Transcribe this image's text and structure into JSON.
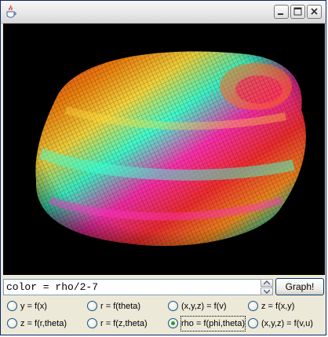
{
  "window": {
    "icon": "java-cup-icon",
    "controls": [
      "minimize-icon",
      "maximize-icon",
      "close-icon"
    ]
  },
  "graph": {
    "description_colors": [
      "#ff3030",
      "#ff8800",
      "#ffe020",
      "#30ffc0",
      "#ff40c0"
    ]
  },
  "input": {
    "value": "color = rho/2-7"
  },
  "graph_button": {
    "label": "Graph!"
  },
  "modes": [
    {
      "label": "y = f(x)",
      "checked": false
    },
    {
      "label": "r = f(theta)",
      "checked": false
    },
    {
      "label": "(x,y,z) = f(v)",
      "checked": false
    },
    {
      "label": "z = f(x,y)",
      "checked": false
    },
    {
      "label": "z = f(r,theta)",
      "checked": false
    },
    {
      "label": "r = f(z,theta)",
      "checked": false
    },
    {
      "label": "rho = f(phi,theta)",
      "checked": true
    },
    {
      "label": "(x,y,z) = f(v,u)",
      "checked": false
    }
  ]
}
